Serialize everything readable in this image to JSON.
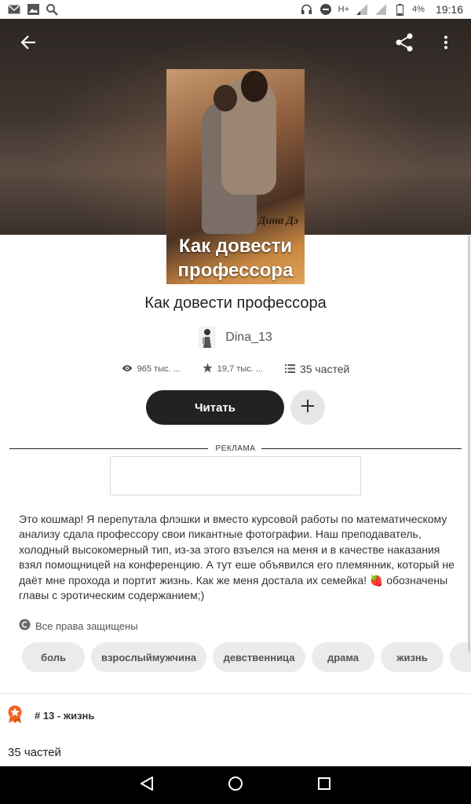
{
  "status_bar": {
    "time": "19:16",
    "battery": "4%",
    "network": "H+",
    "left_icons": [
      "mail-icon",
      "image-icon",
      "search-icon"
    ],
    "right_icons": [
      "headphones-icon",
      "do-not-disturb-icon",
      "signal-icon",
      "battery-icon"
    ]
  },
  "header": {
    "back_icon": "arrow-left-icon",
    "share_icon": "share-icon",
    "more_icon": "more-vertical-icon"
  },
  "cover": {
    "author": "Дина Дэ",
    "title": "Как довести профессора"
  },
  "book": {
    "title": "Как довести профессора",
    "author": "Dina_13",
    "views": "965 тыс. ...",
    "votes": "19,7 тыс. ...",
    "parts": "35 частей"
  },
  "actions": {
    "read_label": "Читать",
    "add_icon": "plus-icon"
  },
  "ad": {
    "label": "РЕКЛАМА"
  },
  "description": "Это кошмар! Я перепутала флэшки и вместо курсовой работы по математическому анализу сдала профессору свои пикантные фотографии. Наш преподаватель, холодный высокомерный тип, из-за этого взъелся на меня и в качестве наказания взял помощницей на конференцию. А тут еше объявился его племянник, который не даёт мне прохода и портит жизнь. Как же меня достала их семейка! 🍓 обозначены главы с эротическим содержанием;)",
  "rights": "Все права защищены",
  "tags": [
    "боль",
    "взрослыймужчина",
    "девственница",
    "драма",
    "жизнь",
    ""
  ],
  "rank": "# 13 - жизнь",
  "parts_title": "35 частей",
  "colors": {
    "primary_button": "#222222",
    "tag_bg": "#ebebeb",
    "rank_badge": "#f26322"
  }
}
